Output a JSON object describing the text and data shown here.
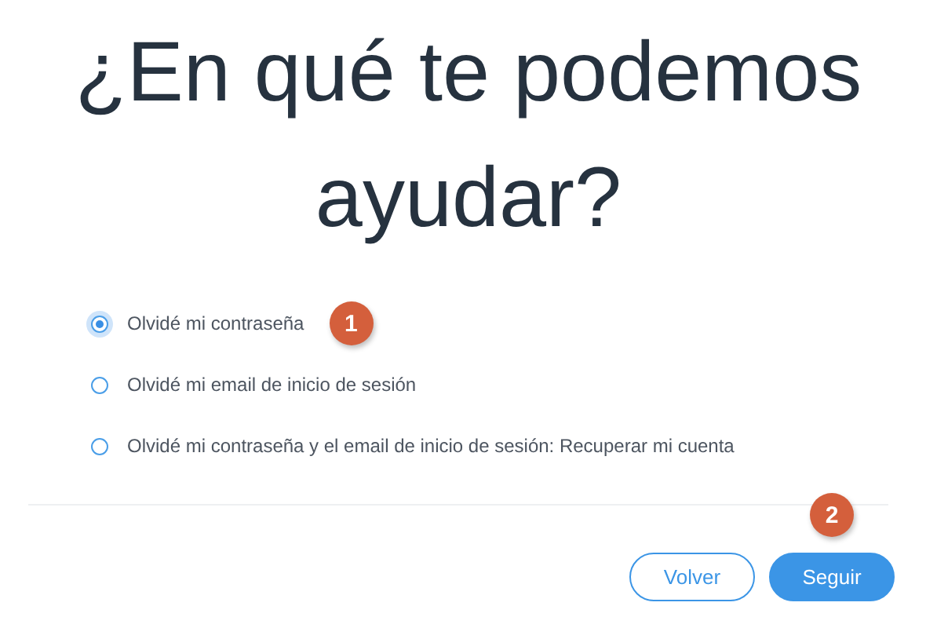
{
  "heading": "¿En qué te podemos ayudar?",
  "options": [
    {
      "label": "Olvidé mi contraseña",
      "selected": true,
      "badge": "1"
    },
    {
      "label": "Olvidé mi email de inicio de sesión",
      "selected": false
    },
    {
      "label": "Olvidé mi contraseña y el email de inicio de sesión: Recuperar mi cuenta",
      "selected": false
    }
  ],
  "buttons": [
    {
      "label": "Volver",
      "kind": "secondary"
    },
    {
      "label": "Seguir",
      "kind": "primary",
      "badge": "2"
    }
  ]
}
